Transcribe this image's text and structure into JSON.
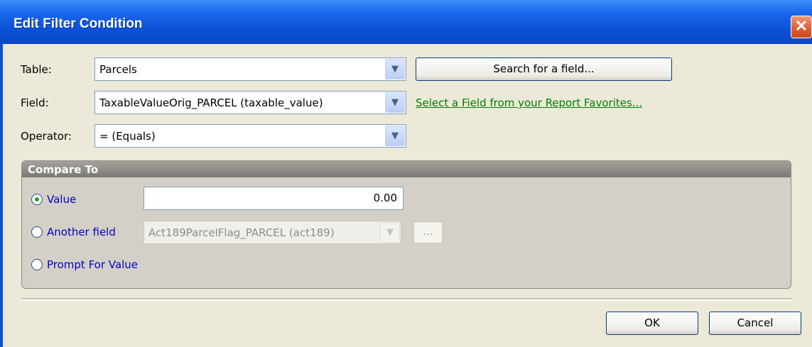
{
  "window": {
    "title": "Edit Filter Condition",
    "close_glyph": "✕"
  },
  "labels": {
    "table": "Table:",
    "field": "Field:",
    "operator": "Operator:"
  },
  "table_select": {
    "value": "Parcels"
  },
  "field_select": {
    "value": "TaxableValueOrig_PARCEL (taxable_value)"
  },
  "operator_select": {
    "value": "= (Equals)"
  },
  "search_button": {
    "label": "Search for a field..."
  },
  "favorites_link": {
    "label": "Select a Field from your Report Favorites..."
  },
  "compare_to": {
    "title": "Compare To",
    "value_option": {
      "label": "Value",
      "checked": true
    },
    "value_input": {
      "value": "0.00"
    },
    "another_field_option": {
      "label": "Another field",
      "checked": false
    },
    "another_field_select": {
      "value": "Act189ParcelFlag_PARCEL (act189)"
    },
    "browse_button": {
      "label": "..."
    },
    "prompt_option": {
      "label": "Prompt For Value",
      "checked": false
    }
  },
  "buttons": {
    "ok": "OK",
    "cancel": "Cancel"
  },
  "icons": {
    "dropdown": "chevron-down-icon",
    "close": "close-icon"
  }
}
